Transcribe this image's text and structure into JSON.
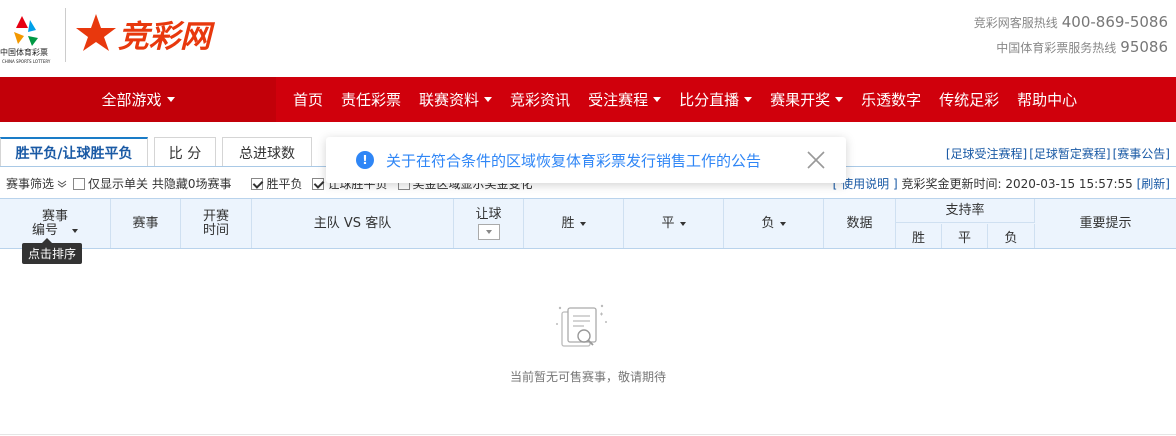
{
  "brand": {
    "logo_name": "竞彩网",
    "cn_text": "中国体育彩票",
    "en_text": "CHINA SPORTS LOTTERY",
    "accent": "#d0000c"
  },
  "hotlines": [
    {
      "label": "竞彩网客服热线",
      "number": "400-869-5086"
    },
    {
      "label": "中国体育彩票服务热线",
      "number": "95086"
    }
  ],
  "nav": {
    "all_games": "全部游戏",
    "items": [
      {
        "label": "首页",
        "dropdown": false
      },
      {
        "label": "责任彩票",
        "dropdown": false
      },
      {
        "label": "联赛资料",
        "dropdown": true
      },
      {
        "label": "竞彩资讯",
        "dropdown": false
      },
      {
        "label": "受注赛程",
        "dropdown": true
      },
      {
        "label": "比分直播",
        "dropdown": true
      },
      {
        "label": "赛果开奖",
        "dropdown": true
      },
      {
        "label": "乐透数字",
        "dropdown": false
      },
      {
        "label": "传统足彩",
        "dropdown": false
      },
      {
        "label": "帮助中心",
        "dropdown": false
      }
    ]
  },
  "tabs": [
    {
      "label": "胜平负/让球胜平负",
      "active": true
    },
    {
      "label": "比 分",
      "active": false
    },
    {
      "label": "总进球数",
      "active": false
    }
  ],
  "right_links": [
    "[足球受注赛程]",
    "[足球暂定赛程]",
    "[赛事公告]"
  ],
  "notice": {
    "icon": "info-icon",
    "text": "关于在符合条件的区域恢复体育彩票发行销售工作的公告"
  },
  "filter": {
    "screen_label": "赛事筛选",
    "single_only": "仅显示单关 共隐藏0场赛事",
    "option_spf": "胜平负",
    "option_rqspf": "让球胜平负",
    "option_extra": "奖金区域显示奖金变化",
    "usage_link": "[ 使用说明 ]",
    "update_label": "竞彩奖金更新时间:",
    "update_time": "2020-03-15 15:57:55",
    "refresh": "[刷新]"
  },
  "table": {
    "col_num": "赛事编号",
    "col_num_l1": "赛事",
    "col_num_l2": "编号",
    "col_match": "赛事",
    "col_time_l1": "开赛",
    "col_time_l2": "时间",
    "col_teams": "主队 VS 客队",
    "col_handicap": "让球",
    "col_win": "胜",
    "col_draw": "平",
    "col_lose": "负",
    "col_data": "数据",
    "col_support": "支持率",
    "sub_win": "胜",
    "sub_draw": "平",
    "sub_lose": "负",
    "col_tips": "重要提示"
  },
  "tooltip": "点击排序",
  "empty_text": "当前暂无可售赛事，敬请期待"
}
